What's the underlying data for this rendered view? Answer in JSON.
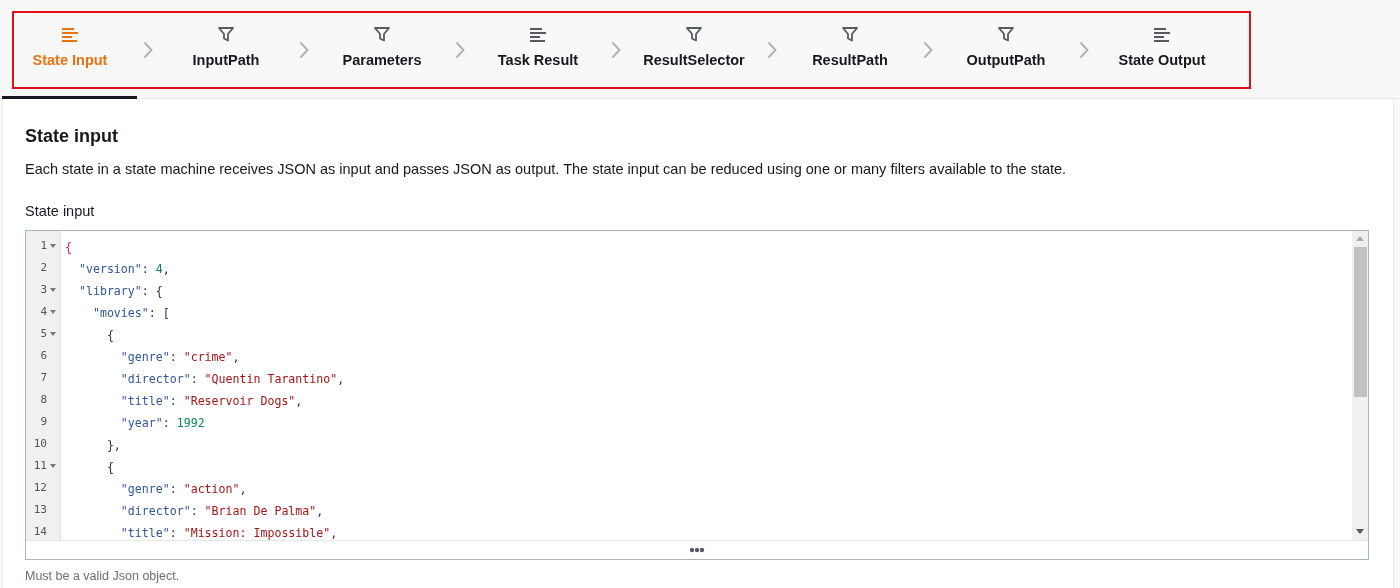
{
  "steps": [
    {
      "label": "State Input",
      "kind": "lines",
      "selected": true
    },
    {
      "label": "InputPath",
      "kind": "filter",
      "selected": false
    },
    {
      "label": "Parameters",
      "kind": "filter",
      "selected": false
    },
    {
      "label": "Task Result",
      "kind": "lines",
      "selected": false
    },
    {
      "label": "ResultSelector",
      "kind": "filter",
      "selected": false
    },
    {
      "label": "ResultPath",
      "kind": "filter",
      "selected": false
    },
    {
      "label": "OutputPath",
      "kind": "filter",
      "selected": false
    },
    {
      "label": "State Output",
      "kind": "lines",
      "selected": false
    }
  ],
  "section": {
    "title": "State input",
    "description": "Each state in a state machine receives JSON as input and passes JSON as output. The state input can be reduced using one or many filters available to the state.",
    "field_label": "State input",
    "hint": "Must be a valid Json object."
  },
  "editor": {
    "lines": [
      {
        "number": "1",
        "foldable": true,
        "tokens": [
          {
            "kind": "brace",
            "text": "{"
          }
        ]
      },
      {
        "number": "2",
        "foldable": false,
        "tokens": [
          {
            "kind": "key",
            "text": "  \"version\""
          },
          {
            "kind": "punct",
            "text": ": "
          },
          {
            "kind": "number",
            "text": "4"
          },
          {
            "kind": "punct",
            "text": ","
          }
        ]
      },
      {
        "number": "3",
        "foldable": true,
        "tokens": [
          {
            "kind": "key",
            "text": "  \"library\""
          },
          {
            "kind": "punct",
            "text": ": {"
          }
        ]
      },
      {
        "number": "4",
        "foldable": true,
        "tokens": [
          {
            "kind": "key",
            "text": "    \"movies\""
          },
          {
            "kind": "punct",
            "text": ": ["
          }
        ]
      },
      {
        "number": "5",
        "foldable": true,
        "tokens": [
          {
            "kind": "punct",
            "text": "      {"
          }
        ]
      },
      {
        "number": "6",
        "foldable": false,
        "tokens": [
          {
            "kind": "key",
            "text": "        \"genre\""
          },
          {
            "kind": "punct",
            "text": ": "
          },
          {
            "kind": "string",
            "text": "\"crime\""
          },
          {
            "kind": "punct",
            "text": ","
          }
        ]
      },
      {
        "number": "7",
        "foldable": false,
        "tokens": [
          {
            "kind": "key",
            "text": "        \"director\""
          },
          {
            "kind": "punct",
            "text": ": "
          },
          {
            "kind": "string",
            "text": "\"Quentin Tarantino\""
          },
          {
            "kind": "punct",
            "text": ","
          }
        ]
      },
      {
        "number": "8",
        "foldable": false,
        "tokens": [
          {
            "kind": "key",
            "text": "        \"title\""
          },
          {
            "kind": "punct",
            "text": ": "
          },
          {
            "kind": "string",
            "text": "\"Reservoir Dogs\""
          },
          {
            "kind": "punct",
            "text": ","
          }
        ]
      },
      {
        "number": "9",
        "foldable": false,
        "tokens": [
          {
            "kind": "key",
            "text": "        \"year\""
          },
          {
            "kind": "punct",
            "text": ": "
          },
          {
            "kind": "number",
            "text": "1992"
          }
        ]
      },
      {
        "number": "10",
        "foldable": false,
        "tokens": [
          {
            "kind": "punct",
            "text": "      },"
          }
        ]
      },
      {
        "number": "11",
        "foldable": true,
        "tokens": [
          {
            "kind": "punct",
            "text": "      {"
          }
        ]
      },
      {
        "number": "12",
        "foldable": false,
        "tokens": [
          {
            "kind": "key",
            "text": "        \"genre\""
          },
          {
            "kind": "punct",
            "text": ": "
          },
          {
            "kind": "string",
            "text": "\"action\""
          },
          {
            "kind": "punct",
            "text": ","
          }
        ]
      },
      {
        "number": "13",
        "foldable": false,
        "tokens": [
          {
            "kind": "key",
            "text": "        \"director\""
          },
          {
            "kind": "punct",
            "text": ": "
          },
          {
            "kind": "string",
            "text": "\"Brian De Palma\""
          },
          {
            "kind": "punct",
            "text": ","
          }
        ]
      },
      {
        "number": "14",
        "foldable": false,
        "tokens": [
          {
            "kind": "key",
            "text": "        \"title\""
          },
          {
            "kind": "punct",
            "text": ": "
          },
          {
            "kind": "string",
            "text": "\"Mission: Impossible\""
          },
          {
            "kind": "punct",
            "text": ","
          }
        ]
      }
    ]
  }
}
